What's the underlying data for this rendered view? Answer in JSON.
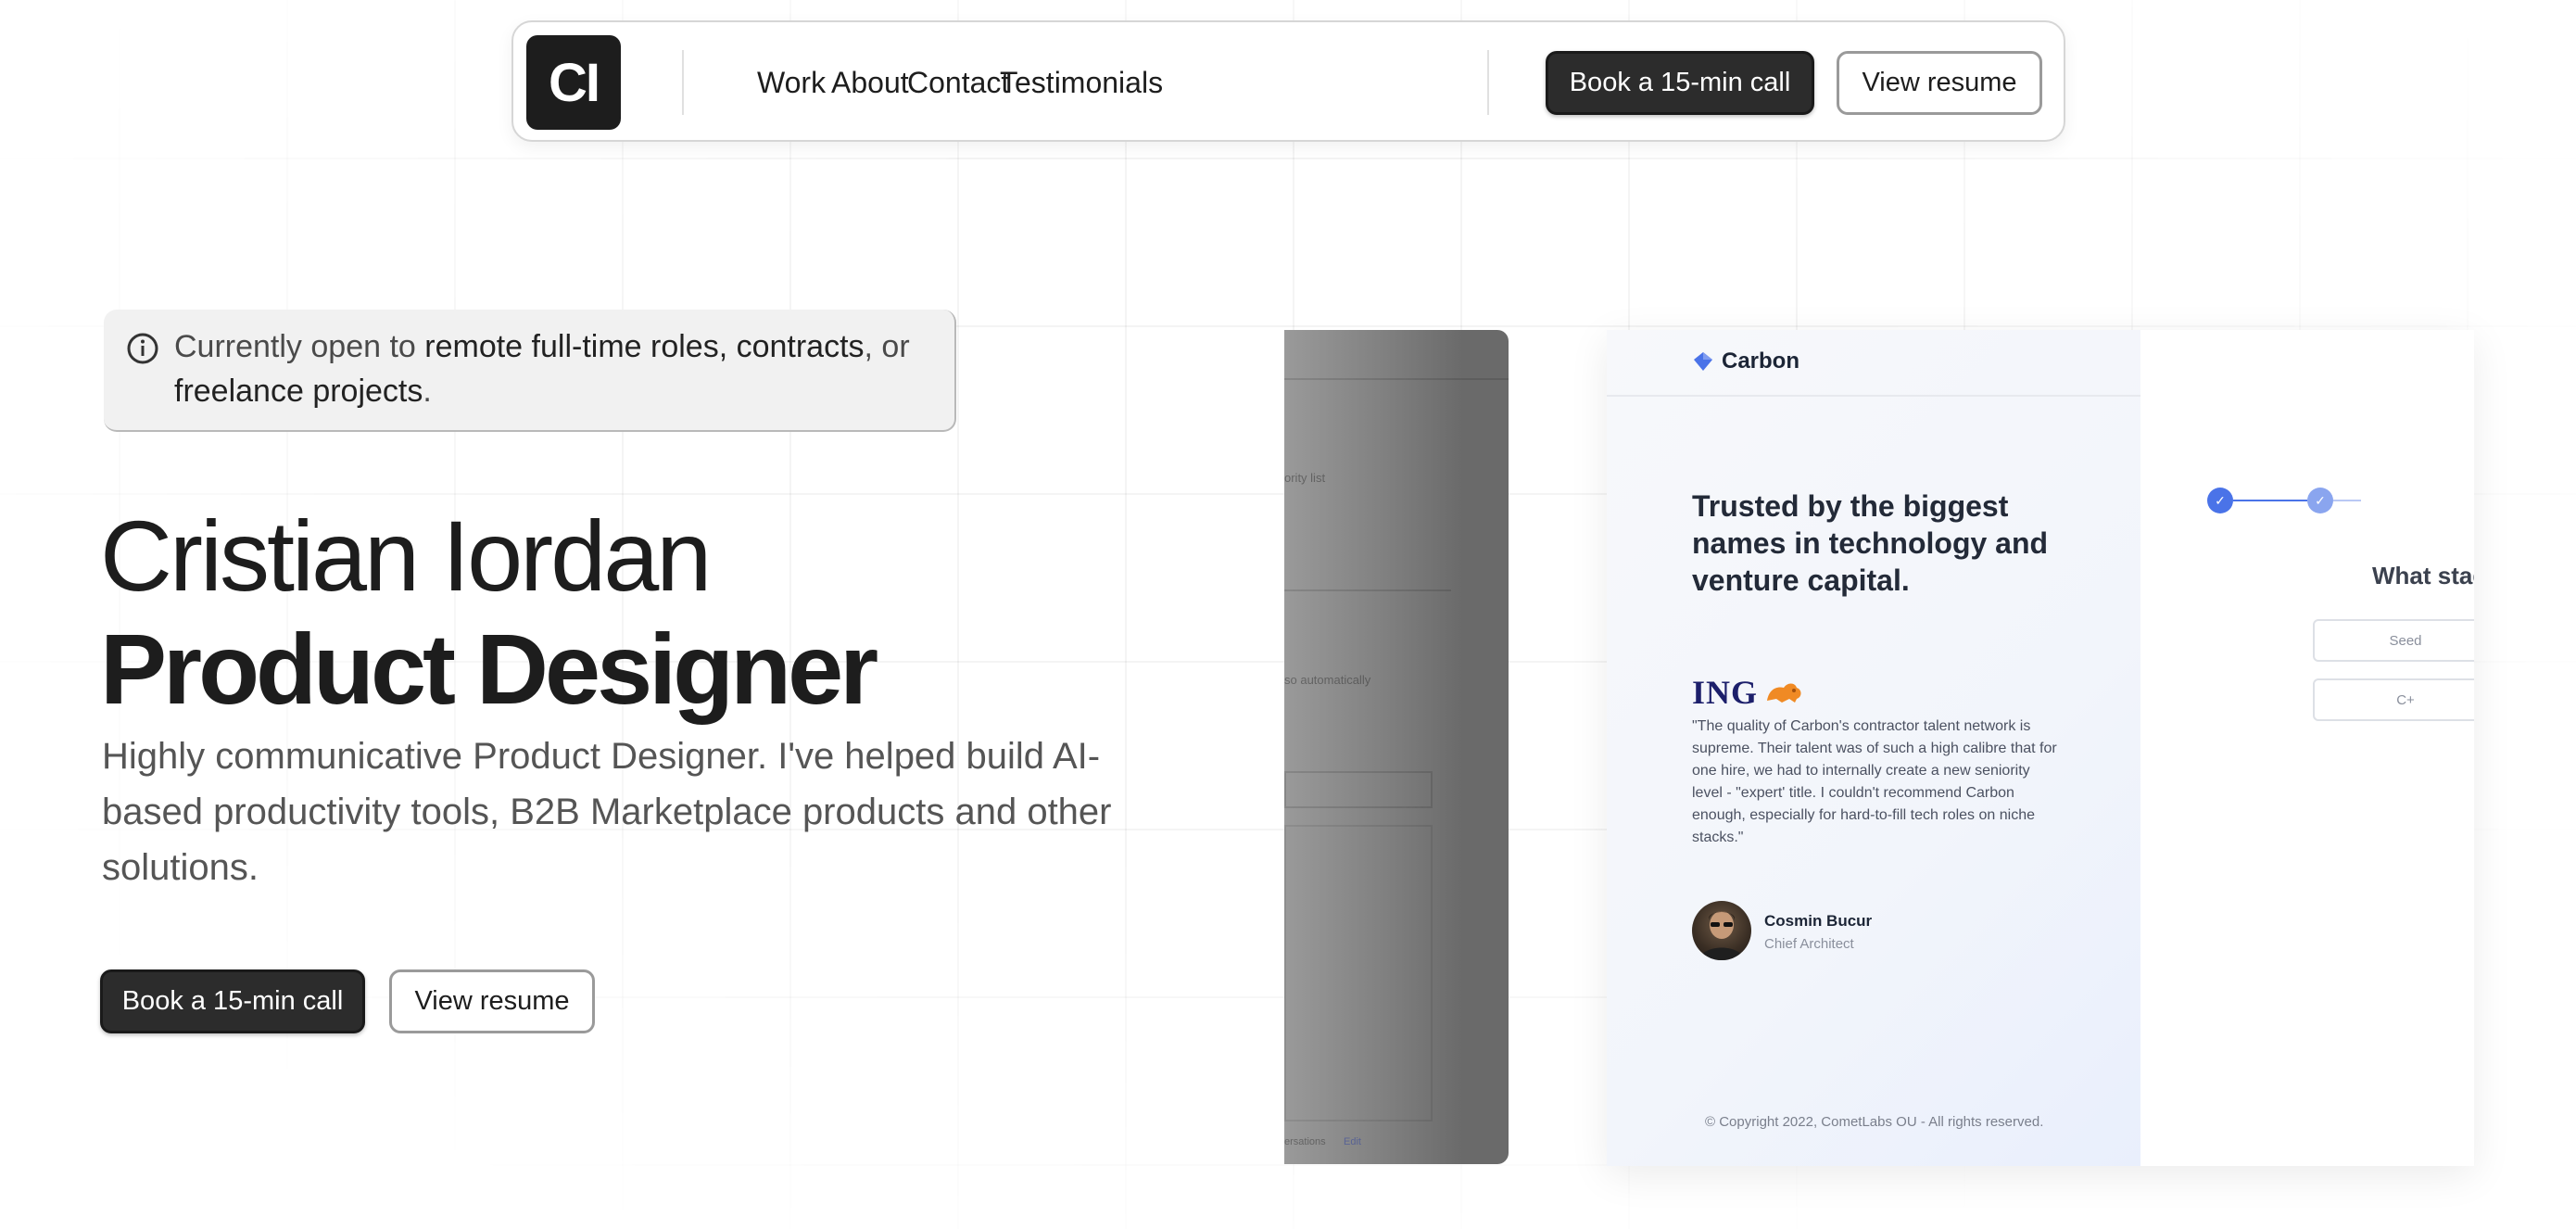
{
  "nav": {
    "logo": "CI",
    "links": [
      "Work",
      "About",
      "Contact",
      "Testimonials"
    ],
    "primary_cta": "Book a 15-min call",
    "secondary_cta": "View resume"
  },
  "banner": {
    "prefix": "Currently open to ",
    "highlight_1": "remote full-time roles, contracts",
    "middle": ", or",
    "highlight_2": "freelance projects",
    "suffix": "."
  },
  "hero": {
    "name": "Cristian Iordan",
    "role": "Product Designer",
    "description": "Highly communicative Product Designer. I've helped build AI-based productivity tools, B2B Marketplace products and other solutions.",
    "primary_cta": "Book a 15-min call",
    "secondary_cta": "View resume"
  },
  "mock_dark": {
    "ghost_1": "ority list",
    "ghost_2": "so automatically",
    "ghost_3": "ersations",
    "ghost_4": "Edit"
  },
  "carbon": {
    "brand": "Carbon",
    "title": "Trusted by the biggest names in technology and venture capital.",
    "client_logo": "ING",
    "quote": "\"The quality of Carbon's contractor talent network is supreme. Their talent was of such a high calibre that for one hire, we had to internally create a new seniority level - \"expert' title. I couldn't recommend Carbon enough, especially for hard-to-fill tech roles on niche stacks.\"",
    "person_name": "Cosmin Bucur",
    "person_role": "Chief Architect",
    "copyright": "© Copyright 2022, CometLabs OU - All rights reserved.",
    "stage_question": "What stag",
    "stage_options": [
      "Seed",
      "C+"
    ]
  },
  "colors": {
    "text": "#1d1d1d",
    "button_dark": "#2c2c2c",
    "banner_bg": "#f1f1f1",
    "carbon_accent": "#4a73e8"
  }
}
